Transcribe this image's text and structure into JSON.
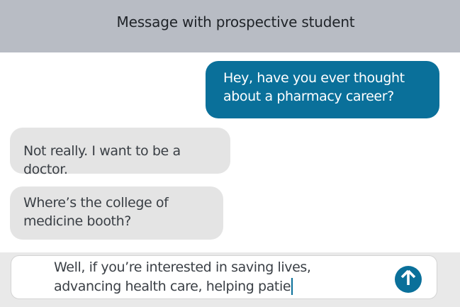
{
  "header": {
    "title": "Message with prospective student"
  },
  "messages": [
    {
      "sender": "self",
      "text": "Hey, have you ever thought about a pharmacy career?"
    },
    {
      "sender": "other",
      "text": "Not really. I want to be a doctor."
    },
    {
      "sender": "other",
      "text": "Where’s the college of medicine booth?"
    }
  ],
  "composer": {
    "draft": "Well, if you’re interested in saving lives, advancing health care, helping patie",
    "send_icon": "arrow-up-icon"
  },
  "colors": {
    "header_bg": "#b8bcc4",
    "sent_bubble": "#0a709a",
    "received_bubble": "#e4e4e4",
    "accent": "#0a709a"
  }
}
